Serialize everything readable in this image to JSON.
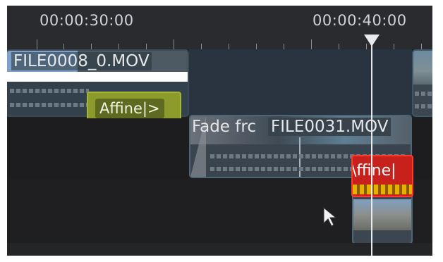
{
  "ruler": {
    "timecode_left": "00:00:30:00",
    "timecode_right": "00:00:40:00"
  },
  "clips": {
    "clip1_name": "FILE0008_0.MOV",
    "clip2_name": "FILE0031.MOV",
    "transition_label": "Fade frc"
  },
  "effects": {
    "affine_green_label": "Affine|>",
    "affine_red_label": "\\ffine|"
  },
  "colors": {
    "track_bg": "#1f1f21",
    "ruler_bg": "#2a2b2e",
    "clip_border": "#3c5666",
    "affine_green": "#8d9a2c",
    "affine_red": "#c8201a",
    "playhead": "#e7e9ec"
  },
  "icons": {
    "playhead_marker": "playhead-triangle-icon",
    "cursor": "mouse-pointer-icon"
  }
}
